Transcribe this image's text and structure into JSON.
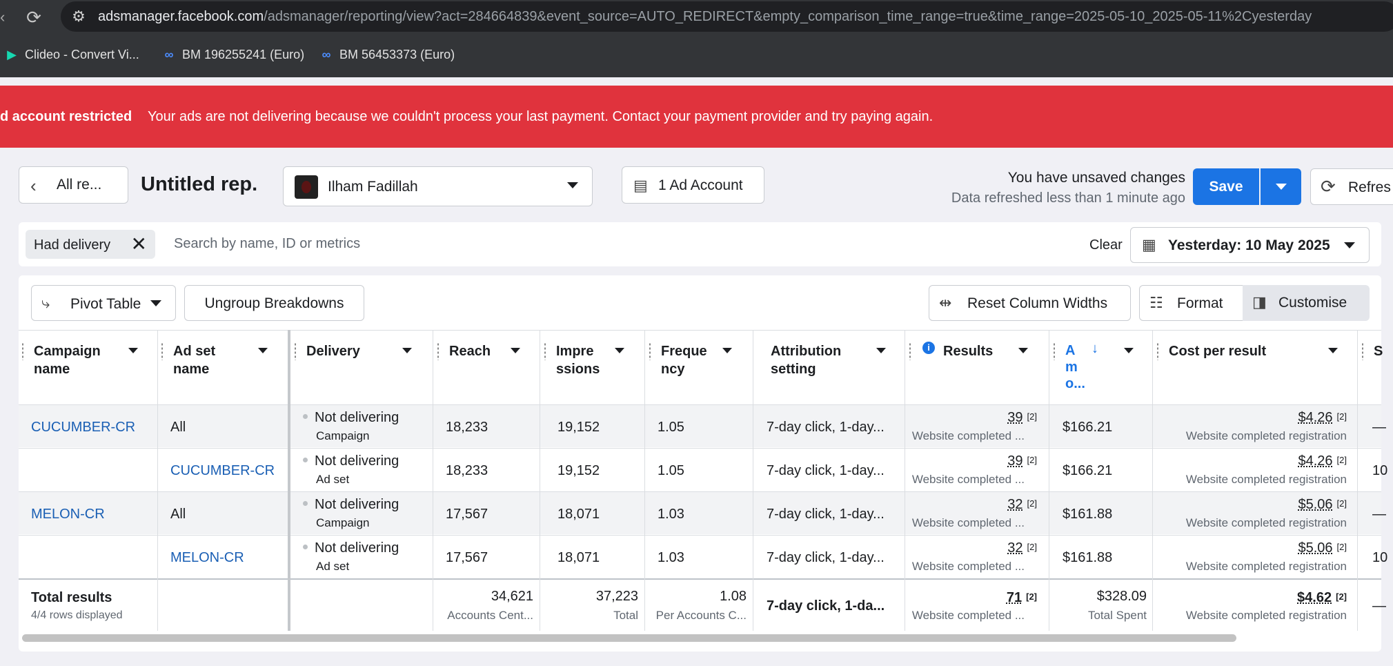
{
  "browser": {
    "url_host": "adsmanager.facebook.com",
    "url_path": "/adsmanager/reporting/view?act=284664839&event_source=AUTO_REDIRECT&empty_comparison_time_range=true&time_range=2025-05-10_2025-05-11%2Cyesterday",
    "bookmarks": [
      {
        "label": "Clideo - Convert Vi...",
        "icon": "clideo-play-icon"
      },
      {
        "label": "BM 196255241 (Euro)",
        "icon": "meta-logo-icon"
      },
      {
        "label": "BM 56453373 (Euro)",
        "icon": "meta-logo-icon"
      }
    ]
  },
  "banner": {
    "title": "d account restricted",
    "message": "Your ads are not delivering because we couldn't process your last payment. Contact your payment provider and try paying again.",
    "color": "#e0333d"
  },
  "header": {
    "back_label": "All re...",
    "report_title": "Untitled rep.",
    "account_name": "Ilham Fadillah",
    "ad_account_label": "1 Ad Account",
    "unsaved_text": "You have unsaved changes",
    "refreshed_text": "Data refreshed less than 1 minute ago",
    "save_label": "Save",
    "refresh_label": "Refres",
    "accent": "#1b74e4"
  },
  "filters": {
    "chip_label": "Had delivery",
    "search_placeholder": "Search by name, ID or metrics",
    "clear_label": "Clear",
    "date_label": "Yesterday: 10 May 2025"
  },
  "toolbar": {
    "pivot_label": "Pivot Table",
    "ungroup_label": "Ungroup Breakdowns",
    "reset_label": "Reset Column Widths",
    "format_label": "Format",
    "customise_label": "Customise"
  },
  "columns": {
    "campaign": "Campaign\nname",
    "adset": "Ad set\nname",
    "delivery": "Delivery",
    "reach": "Reach",
    "impressions": "Impre\nssions",
    "frequency": "Freque\nncy",
    "attribution": "Attribution\nsetting",
    "results": "Results",
    "amount": "A\nm\no...",
    "cost": "Cost per result",
    "next": "S"
  },
  "rows": [
    {
      "campaign": "CUCUMBER-CR",
      "adset": "All",
      "delivery": "Not delivering",
      "level": "Campaign",
      "reach": "18,233",
      "impressions": "19,152",
      "frequency": "1.05",
      "attribution": "7-day click, 1-day...",
      "results": "39",
      "results_fn": "[2]",
      "results_sub": "Website completed ...",
      "amount": "$166.21",
      "cost": "$4.26",
      "cost_fn": "[2]",
      "cost_sub": "Website completed registration",
      "next": "—"
    },
    {
      "campaign": "",
      "adset": "CUCUMBER-CR",
      "delivery": "Not delivering",
      "level": "Ad set",
      "reach": "18,233",
      "impressions": "19,152",
      "frequency": "1.05",
      "attribution": "7-day click, 1-day...",
      "results": "39",
      "results_fn": "[2]",
      "results_sub": "Website completed ...",
      "amount": "$166.21",
      "cost": "$4.26",
      "cost_fn": "[2]",
      "cost_sub": "Website completed registration",
      "next": "10"
    },
    {
      "campaign": "MELON-CR",
      "adset": "All",
      "delivery": "Not delivering",
      "level": "Campaign",
      "reach": "17,567",
      "impressions": "18,071",
      "frequency": "1.03",
      "attribution": "7-day click, 1-day...",
      "results": "32",
      "results_fn": "[2]",
      "results_sub": "Website completed ...",
      "amount": "$161.88",
      "cost": "$5.06",
      "cost_fn": "[2]",
      "cost_sub": "Website completed registration",
      "next": "—"
    },
    {
      "campaign": "",
      "adset": "MELON-CR",
      "delivery": "Not delivering",
      "level": "Ad set",
      "reach": "17,567",
      "impressions": "18,071",
      "frequency": "1.03",
      "attribution": "7-day click, 1-day...",
      "results": "32",
      "results_fn": "[2]",
      "results_sub": "Website completed ...",
      "amount": "$161.88",
      "cost": "$5.06",
      "cost_fn": "[2]",
      "cost_sub": "Website completed registration",
      "next": "10"
    }
  ],
  "totals": {
    "label": "Total results",
    "rows_displayed": "4/4 rows displayed",
    "reach": "34,621",
    "reach_sub": "Accounts Cent...",
    "impressions": "37,223",
    "impressions_sub": "Total",
    "frequency": "1.08",
    "frequency_sub": "Per Accounts C...",
    "attribution": "7-day click, 1-da...",
    "results": "71",
    "results_fn": "[2]",
    "results_sub": "Website completed ...",
    "amount": "$328.09",
    "amount_sub": "Total Spent",
    "cost": "$4.62",
    "cost_fn": "[2]",
    "cost_sub": "Website completed registration",
    "next": "—"
  }
}
